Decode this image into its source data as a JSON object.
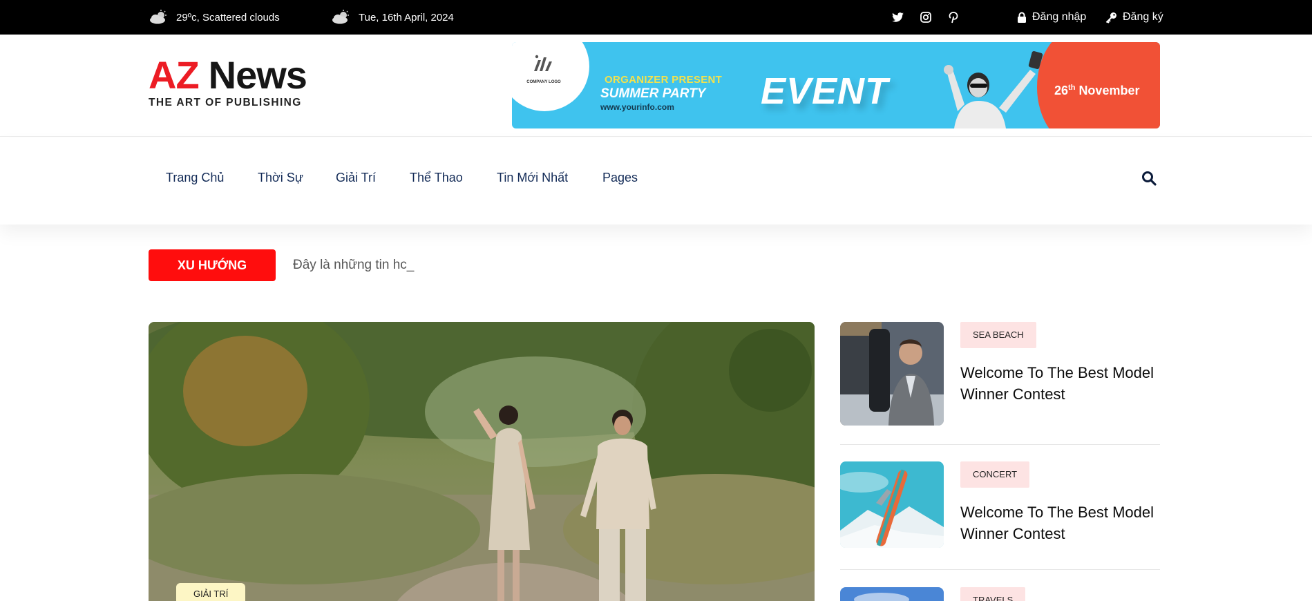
{
  "topbar": {
    "weather": "29ºc, Scattered clouds",
    "date": "Tue, 16th April, 2024",
    "login": "Đăng nhập",
    "register": "Đăng ký"
  },
  "logo": {
    "brand_a": "AZ",
    "brand_b": "News",
    "tagline": "THE ART OF PUBLISHING"
  },
  "banner": {
    "company": "COMPANY LOGO",
    "organizer": "ORGANIZER PRESENT",
    "party": "SUMMER PARTY",
    "url": "www.yourinfo.com",
    "event": "EVENT",
    "day": "26",
    "day_suffix": "th",
    "month": "November"
  },
  "nav": {
    "items": [
      "Trang Chủ",
      "Thời Sự",
      "Giải Trí",
      "Thể Thao",
      "Tin Mới Nhất",
      "Pages"
    ]
  },
  "trending": {
    "label": "XU HƯỚNG",
    "ticker": "Đây là những tin hc_"
  },
  "feature": {
    "tag": "GIẢI TRÍ"
  },
  "posts": [
    {
      "tag": "SEA BEACH",
      "title": "Welcome To The Best Model Winner Contest"
    },
    {
      "tag": "CONCERT",
      "title": "Welcome To The Best Model Winner Contest"
    },
    {
      "tag": "TRAVELS",
      "title": ""
    }
  ]
}
